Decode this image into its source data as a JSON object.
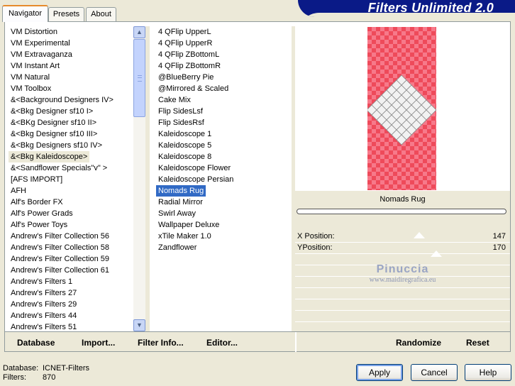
{
  "banner": {
    "title": "Filters Unlimited 2.0"
  },
  "tabs": [
    {
      "label": "Navigator",
      "active": true
    },
    {
      "label": "Presets",
      "active": false
    },
    {
      "label": "About",
      "active": false
    }
  ],
  "categories": [
    "VM Distortion",
    "VM Experimental",
    "VM Extravaganza",
    "VM Instant Art",
    "VM Natural",
    "VM Toolbox",
    "&<Background Designers IV>",
    "&<Bkg Designer sf10 I>",
    "&<BKg Designer sf10 II>",
    "&<Bkg Designer sf10 III>",
    "&<Bkg Designers sf10 IV>",
    "&<Bkg Kaleidoscope>",
    "&<Sandflower Specials\"v\" >",
    "[AFS IMPORT]",
    "AFH",
    "Alf's Border FX",
    "Alf's Power Grads",
    "Alf's Power Toys",
    "Andrew's Filter Collection 56",
    "Andrew's Filter Collection 58",
    "Andrew's Filter Collection 59",
    "Andrew's Filter Collection 61",
    "Andrew's Filters 1",
    "Andrew's Filters 27",
    "Andrew's Filters 29",
    "Andrew's Filters 44",
    "Andrew's Filters 51"
  ],
  "selected_category": "&<Bkg Kaleidoscope>",
  "filters": [
    "4 QFlip UpperL",
    "4 QFlip UpperR",
    "4 QFlip ZBottomL",
    "4 QFlip ZBottomR",
    "@BlueBerry Pie",
    "@Mirrored & Scaled",
    "Cake Mix",
    "Flip SidesLsf",
    "Flip SidesRsf",
    "Kaleidoscope 1",
    "Kaleidoscope 5",
    "Kaleidoscope 8",
    "Kaleidoscope Flower",
    "Kaleidoscope Persian",
    "Nomads Rug",
    "Radial Mirror",
    "Swirl Away",
    "Wallpaper Deluxe",
    "xTile Maker 1.0",
    "Zandflower"
  ],
  "selected_filter": "Nomads Rug",
  "preview": {
    "filter_name": "Nomads Rug",
    "params": [
      {
        "label": "X Position:",
        "value": "147",
        "level": 147
      },
      {
        "label": "YPosition:",
        "value": "170",
        "level": 170
      }
    ]
  },
  "watermark": {
    "line1": "Pinuccia",
    "line2": "www.maidiregrafica.eu"
  },
  "bottom_links": [
    "Database",
    "Import...",
    "Filter Info...",
    "Editor...",
    "Randomize",
    "Reset"
  ],
  "status": {
    "database_label": "Database:",
    "database_value": "ICNET-Filters",
    "filters_label": "Filters:",
    "filters_value": "870"
  },
  "buttons": {
    "apply": "Apply",
    "cancel": "Cancel",
    "help": "Help"
  },
  "colors": {
    "banner": "#0a1a87",
    "selection": "#316ac5",
    "checker_dark": "#ee4a5a",
    "checker_light": "#f7798a"
  }
}
